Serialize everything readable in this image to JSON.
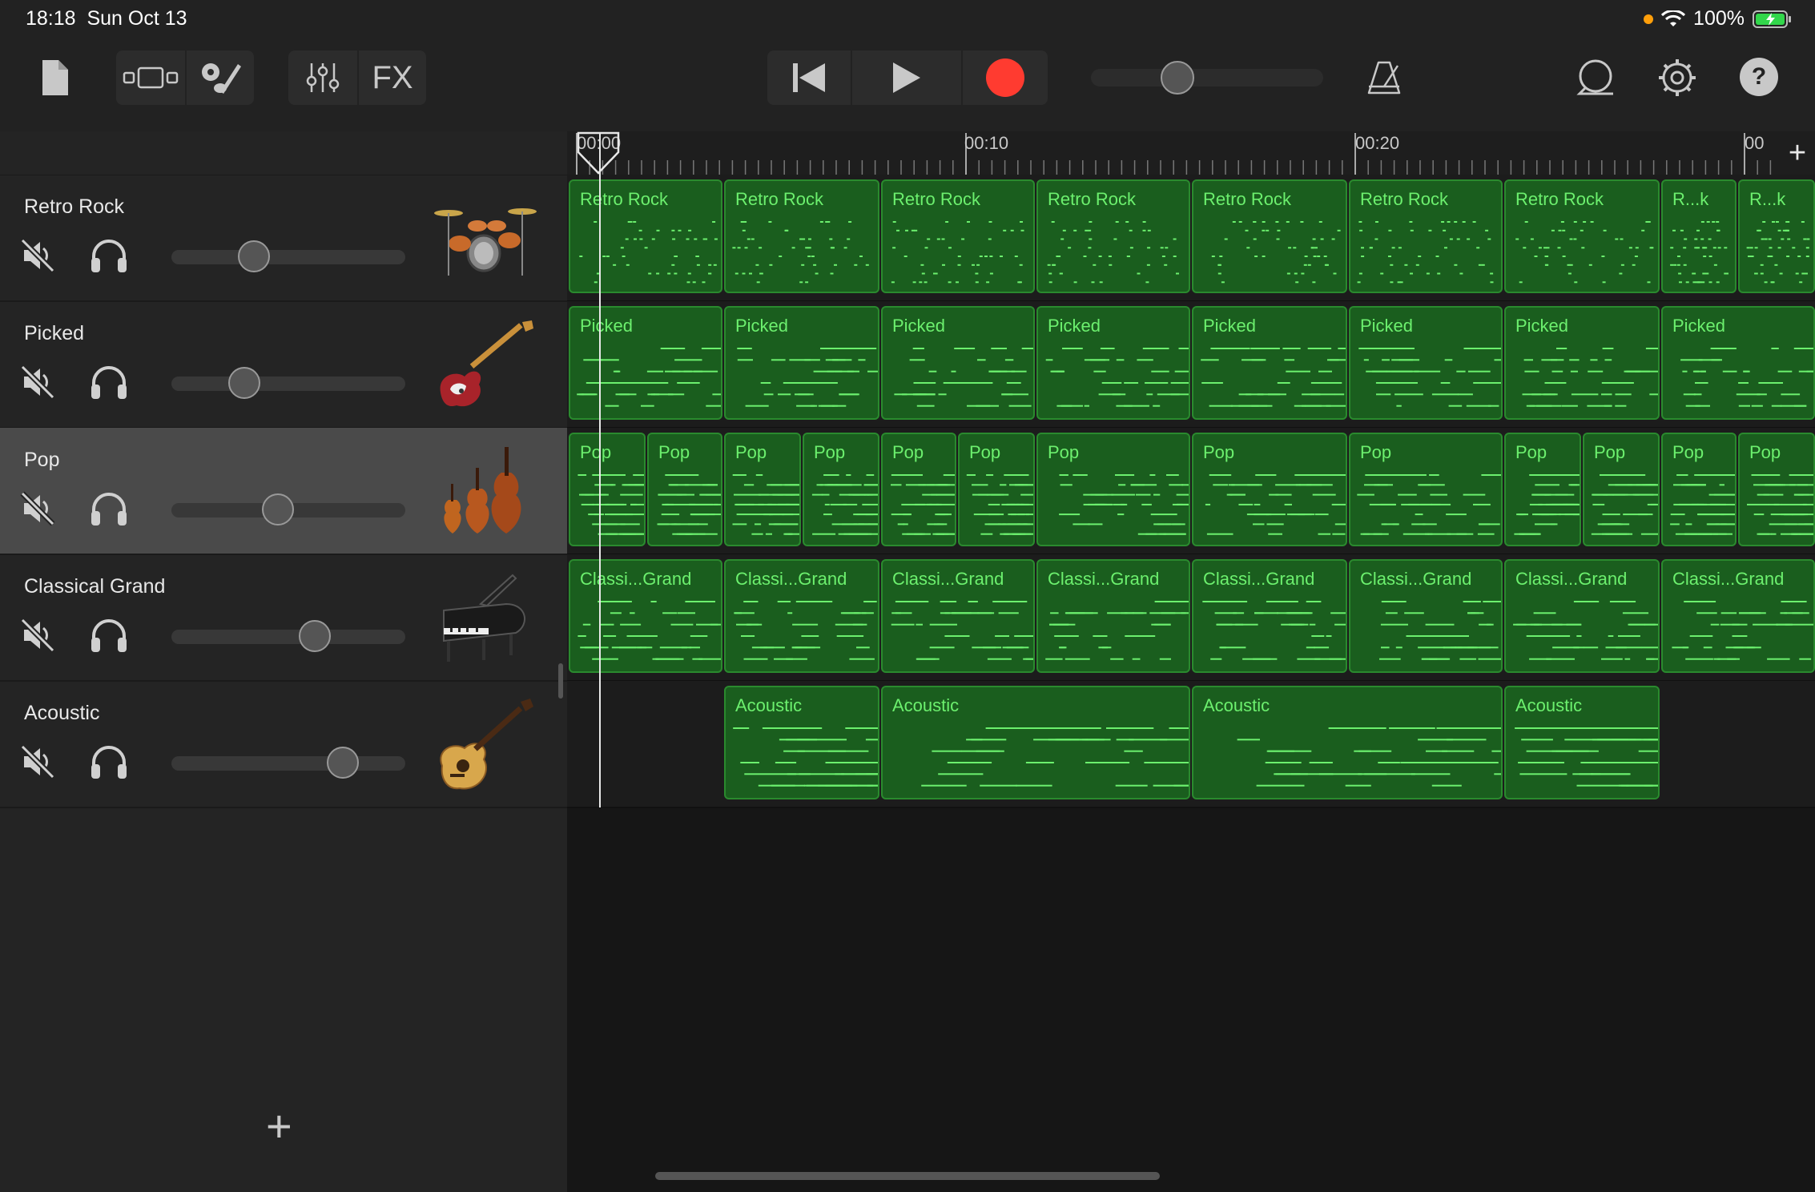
{
  "status_bar": {
    "time": "18:18",
    "date": "Sun Oct 13",
    "battery": "100%",
    "icons": [
      "camera-indicator-dot",
      "wifi-icon",
      "battery-charging-icon"
    ]
  },
  "toolbar": {
    "left": [
      "my-songs-icon",
      "view-toggle-icon",
      "instrument-settings-icon",
      "mixer-icon"
    ],
    "fx_label": "FX",
    "transport": [
      "go-to-beginning-icon",
      "play-icon",
      "record-icon"
    ],
    "master_volume_level": 0.35,
    "right": [
      "metronome-icon",
      "loop-browser-icon",
      "settings-gear-icon",
      "help-icon"
    ],
    "help_label": "?",
    "record_color": "#ff3b30"
  },
  "ruler": {
    "labels": [
      "00:00",
      "00:10",
      "00:20",
      "00"
    ],
    "add_section_label": "+"
  },
  "tracks": [
    {
      "name": "Retro Rock",
      "instrument": "drum-kit",
      "volume": 0.33
    },
    {
      "name": "Picked",
      "instrument": "bass-guitar",
      "volume": 0.28
    },
    {
      "name": "Pop",
      "instrument": "strings",
      "volume": 0.45
    },
    {
      "name": "Classical Grand",
      "instrument": "grand-piano",
      "volume": 0.63
    },
    {
      "name": "Acoustic",
      "instrument": "acoustic-guitar",
      "volume": 0.77
    }
  ],
  "add_track_label": "+",
  "regions": [
    {
      "lane": 0,
      "label": "Retro Rock"
    },
    {
      "lane": 0,
      "label": "Retro Rock"
    },
    {
      "lane": 0,
      "label": "Retro Rock"
    },
    {
      "lane": 0,
      "label": "Retro Rock"
    },
    {
      "lane": 0,
      "label": "Retro Rock"
    },
    {
      "lane": 0,
      "label": "Retro Rock"
    },
    {
      "lane": 0,
      "label": "Retro Rock"
    },
    {
      "lane": 0,
      "label": "R...k"
    },
    {
      "lane": 0,
      "label": "R...k"
    },
    {
      "lane": 1,
      "label": "Picked"
    },
    {
      "lane": 1,
      "label": "Picked"
    },
    {
      "lane": 1,
      "label": "Picked"
    },
    {
      "lane": 1,
      "label": "Picked"
    },
    {
      "lane": 1,
      "label": "Picked"
    },
    {
      "lane": 1,
      "label": "Picked"
    },
    {
      "lane": 1,
      "label": "Picked"
    },
    {
      "lane": 1,
      "label": "Picked"
    },
    {
      "lane": 2,
      "label": "Pop"
    },
    {
      "lane": 2,
      "label": "Pop"
    },
    {
      "lane": 2,
      "label": "Pop"
    },
    {
      "lane": 2,
      "label": "Pop"
    },
    {
      "lane": 2,
      "label": "Pop"
    },
    {
      "lane": 2,
      "label": "Pop"
    },
    {
      "lane": 2,
      "label": "Pop"
    },
    {
      "lane": 2,
      "label": "Pop"
    },
    {
      "lane": 2,
      "label": "Pop"
    },
    {
      "lane": 2,
      "label": "Pop"
    },
    {
      "lane": 2,
      "label": "Pop"
    },
    {
      "lane": 2,
      "label": "Pop"
    },
    {
      "lane": 2,
      "label": "Pop"
    },
    {
      "lane": 3,
      "label": "Classi...Grand"
    },
    {
      "lane": 3,
      "label": "Classi...Grand"
    },
    {
      "lane": 3,
      "label": "Classi...Grand"
    },
    {
      "lane": 3,
      "label": "Classi...Grand"
    },
    {
      "lane": 3,
      "label": "Classi...Grand"
    },
    {
      "lane": 3,
      "label": "Classi...Grand"
    },
    {
      "lane": 3,
      "label": "Classi...Grand"
    },
    {
      "lane": 3,
      "label": "Classi...Grand"
    },
    {
      "lane": 4,
      "label": "Acoustic"
    },
    {
      "lane": 4,
      "label": "Acoustic"
    },
    {
      "lane": 4,
      "label": "Acoustic"
    },
    {
      "lane": 4,
      "label": "Acoustic"
    }
  ]
}
